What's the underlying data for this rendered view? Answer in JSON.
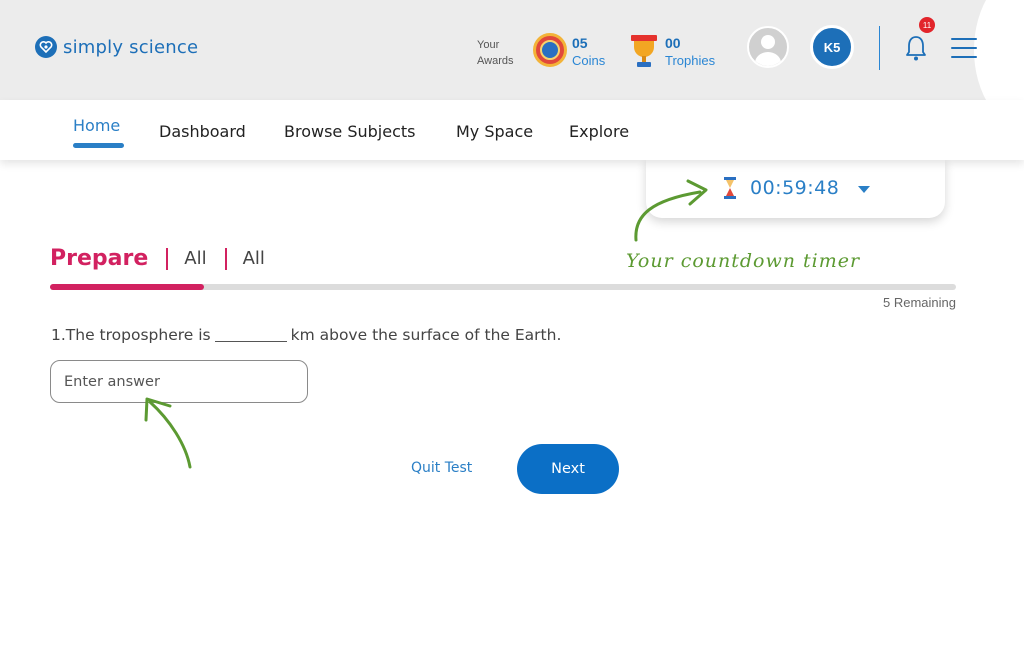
{
  "header": {
    "logo_text": "simply science",
    "awards_label_line1": "Your",
    "awards_label_line2": "Awards",
    "coins": {
      "value": "05",
      "label": "Coins"
    },
    "trophies": {
      "value": "00",
      "label": "Trophies"
    },
    "user_initials": "K5",
    "notification_count": "11"
  },
  "nav": {
    "items": [
      {
        "label": "Home",
        "active": true
      },
      {
        "label": "Dashboard"
      },
      {
        "label": "Browse Subjects"
      },
      {
        "label": "My Space"
      },
      {
        "label": "Explore"
      }
    ]
  },
  "timer": {
    "value": "00:59:48"
  },
  "annotation": {
    "timer_note": "Your countdown timer"
  },
  "test": {
    "breadcrumb": [
      "Prepare",
      "All",
      "All"
    ],
    "progress_fraction": 0.17,
    "remaining_text": "5 Remaining",
    "question_before": "1.The troposphere is",
    "question_after": "km above the surface of the Earth.",
    "answer_placeholder": "Enter answer",
    "quit_label": "Quit Test",
    "next_label": "Next"
  },
  "colors": {
    "brand_blue": "#1d6fb8",
    "accent_pink": "#d22160",
    "annotation_green": "#5c9a32",
    "next_button": "#0b6fc6"
  },
  "icons": [
    "heart-shield-icon",
    "coin-icon",
    "trophy-icon",
    "avatar-icon",
    "bell-icon",
    "hamburger-menu-icon",
    "hourglass-icon",
    "caret-down-icon",
    "annotation-arrow-icon"
  ]
}
